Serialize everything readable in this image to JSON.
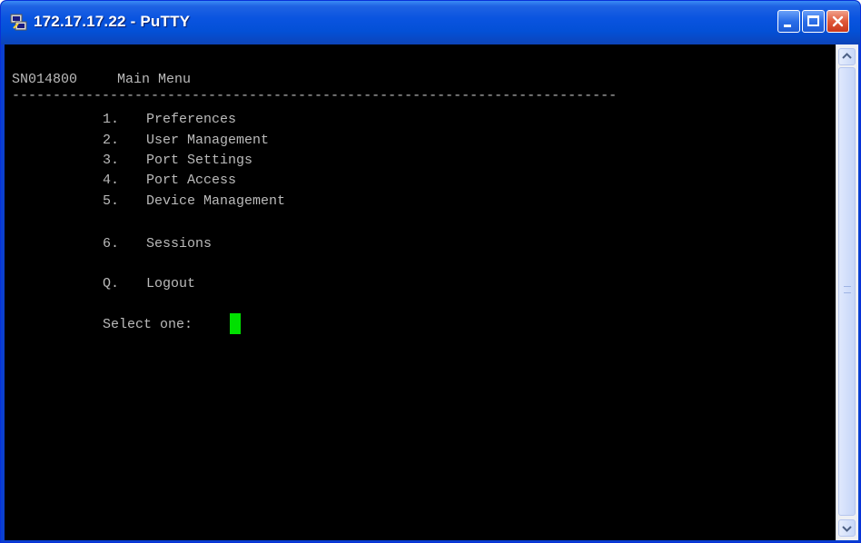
{
  "window": {
    "title": "172.17.17.22 - PuTTY",
    "icon": "putty-icon"
  },
  "titlebar_buttons": {
    "minimize_icon": "minimize-icon",
    "maximize_icon": "maximize-icon",
    "close_icon": "close-icon"
  },
  "terminal": {
    "header": {
      "serial": "SN014800",
      "menu_title": "Main Menu"
    },
    "divider": "--------------------------------------------------------------------------",
    "menu_items": [
      {
        "key": "1.",
        "label": "Preferences"
      },
      {
        "key": "2.",
        "label": "User Management"
      },
      {
        "key": "3.",
        "label": "Port Settings"
      },
      {
        "key": "4.",
        "label": "Port Access"
      },
      {
        "key": "5.",
        "label": "Device Management"
      },
      {
        "key": "6.",
        "label": "Sessions"
      },
      {
        "key": "Q.",
        "label": "Logout"
      }
    ],
    "prompt": "Select one:",
    "text_color": "#bbbbbb",
    "cursor_color": "#00e000",
    "background": "#000000"
  },
  "scrollbar": {
    "up_icon": "scroll-up-arrow-icon",
    "down_icon": "scroll-down-arrow-icon"
  }
}
